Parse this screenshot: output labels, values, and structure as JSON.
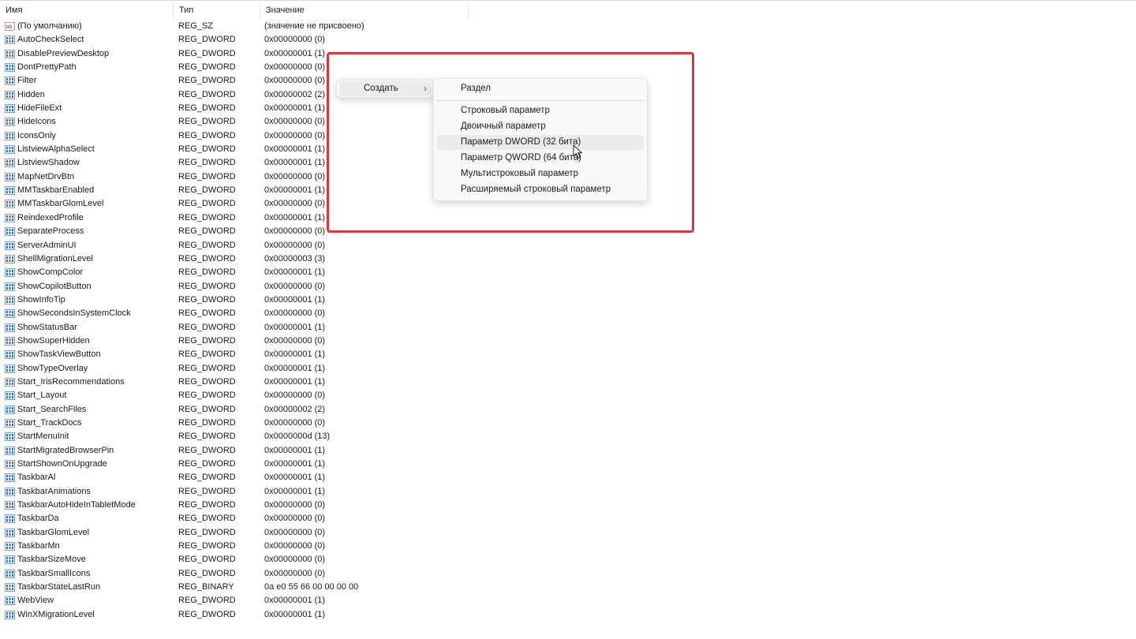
{
  "columns": {
    "name": "Имя",
    "type": "Тип",
    "value": "Значение"
  },
  "rows": [
    {
      "name": "(По умолчанию)",
      "type": "REG_SZ",
      "value": "(значение не присвоено)",
      "icon": "string-value-icon"
    },
    {
      "name": "AutoCheckSelect",
      "type": "REG_DWORD",
      "value": "0x00000000 (0)",
      "icon": "binary-value-icon"
    },
    {
      "name": "DisablePreviewDesktop",
      "type": "REG_DWORD",
      "value": "0x00000001 (1)",
      "icon": "binary-value-icon"
    },
    {
      "name": "DontPrettyPath",
      "type": "REG_DWORD",
      "value": "0x00000000 (0)",
      "icon": "binary-value-icon"
    },
    {
      "name": "Filter",
      "type": "REG_DWORD",
      "value": "0x00000000 (0)",
      "icon": "binary-value-icon"
    },
    {
      "name": "Hidden",
      "type": "REG_DWORD",
      "value": "0x00000002 (2)",
      "icon": "binary-value-icon"
    },
    {
      "name": "HideFileExt",
      "type": "REG_DWORD",
      "value": "0x00000001 (1)",
      "icon": "binary-value-icon"
    },
    {
      "name": "HideIcons",
      "type": "REG_DWORD",
      "value": "0x00000000 (0)",
      "icon": "binary-value-icon"
    },
    {
      "name": "IconsOnly",
      "type": "REG_DWORD",
      "value": "0x00000000 (0)",
      "icon": "binary-value-icon"
    },
    {
      "name": "ListviewAlphaSelect",
      "type": "REG_DWORD",
      "value": "0x00000001 (1)",
      "icon": "binary-value-icon"
    },
    {
      "name": "ListviewShadow",
      "type": "REG_DWORD",
      "value": "0x00000001 (1)",
      "icon": "binary-value-icon"
    },
    {
      "name": "MapNetDrvBtn",
      "type": "REG_DWORD",
      "value": "0x00000000 (0)",
      "icon": "binary-value-icon"
    },
    {
      "name": "MMTaskbarEnabled",
      "type": "REG_DWORD",
      "value": "0x00000001 (1)",
      "icon": "binary-value-icon"
    },
    {
      "name": "MMTaskbarGlomLevel",
      "type": "REG_DWORD",
      "value": "0x00000000 (0)",
      "icon": "binary-value-icon"
    },
    {
      "name": "ReindexedProfile",
      "type": "REG_DWORD",
      "value": "0x00000001 (1)",
      "icon": "binary-value-icon"
    },
    {
      "name": "SeparateProcess",
      "type": "REG_DWORD",
      "value": "0x00000000 (0)",
      "icon": "binary-value-icon"
    },
    {
      "name": "ServerAdminUI",
      "type": "REG_DWORD",
      "value": "0x00000000 (0)",
      "icon": "binary-value-icon"
    },
    {
      "name": "ShellMigrationLevel",
      "type": "REG_DWORD",
      "value": "0x00000003 (3)",
      "icon": "binary-value-icon"
    },
    {
      "name": "ShowCompColor",
      "type": "REG_DWORD",
      "value": "0x00000001 (1)",
      "icon": "binary-value-icon"
    },
    {
      "name": "ShowCopilotButton",
      "type": "REG_DWORD",
      "value": "0x00000000 (0)",
      "icon": "binary-value-icon"
    },
    {
      "name": "ShowInfoTip",
      "type": "REG_DWORD",
      "value": "0x00000001 (1)",
      "icon": "binary-value-icon"
    },
    {
      "name": "ShowSecondsInSystemClock",
      "type": "REG_DWORD",
      "value": "0x00000000 (0)",
      "icon": "binary-value-icon"
    },
    {
      "name": "ShowStatusBar",
      "type": "REG_DWORD",
      "value": "0x00000001 (1)",
      "icon": "binary-value-icon"
    },
    {
      "name": "ShowSuperHidden",
      "type": "REG_DWORD",
      "value": "0x00000000 (0)",
      "icon": "binary-value-icon"
    },
    {
      "name": "ShowTaskViewButton",
      "type": "REG_DWORD",
      "value": "0x00000001 (1)",
      "icon": "binary-value-icon"
    },
    {
      "name": "ShowTypeOverlay",
      "type": "REG_DWORD",
      "value": "0x00000001 (1)",
      "icon": "binary-value-icon"
    },
    {
      "name": "Start_IrisRecommendations",
      "type": "REG_DWORD",
      "value": "0x00000001 (1)",
      "icon": "binary-value-icon"
    },
    {
      "name": "Start_Layout",
      "type": "REG_DWORD",
      "value": "0x00000000 (0)",
      "icon": "binary-value-icon"
    },
    {
      "name": "Start_SearchFiles",
      "type": "REG_DWORD",
      "value": "0x00000002 (2)",
      "icon": "binary-value-icon"
    },
    {
      "name": "Start_TrackDocs",
      "type": "REG_DWORD",
      "value": "0x00000000 (0)",
      "icon": "binary-value-icon"
    },
    {
      "name": "StartMenuInit",
      "type": "REG_DWORD",
      "value": "0x0000000d (13)",
      "icon": "binary-value-icon"
    },
    {
      "name": "StartMigratedBrowserPin",
      "type": "REG_DWORD",
      "value": "0x00000001 (1)",
      "icon": "binary-value-icon"
    },
    {
      "name": "StartShownOnUpgrade",
      "type": "REG_DWORD",
      "value": "0x00000001 (1)",
      "icon": "binary-value-icon"
    },
    {
      "name": "TaskbarAl",
      "type": "REG_DWORD",
      "value": "0x00000001 (1)",
      "icon": "binary-value-icon"
    },
    {
      "name": "TaskbarAnimations",
      "type": "REG_DWORD",
      "value": "0x00000001 (1)",
      "icon": "binary-value-icon"
    },
    {
      "name": "TaskbarAutoHideInTabletMode",
      "type": "REG_DWORD",
      "value": "0x00000000 (0)",
      "icon": "binary-value-icon"
    },
    {
      "name": "TaskbarDa",
      "type": "REG_DWORD",
      "value": "0x00000000 (0)",
      "icon": "binary-value-icon"
    },
    {
      "name": "TaskbarGlomLevel",
      "type": "REG_DWORD",
      "value": "0x00000000 (0)",
      "icon": "binary-value-icon"
    },
    {
      "name": "TaskbarMn",
      "type": "REG_DWORD",
      "value": "0x00000000 (0)",
      "icon": "binary-value-icon"
    },
    {
      "name": "TaskbarSizeMove",
      "type": "REG_DWORD",
      "value": "0x00000000 (0)",
      "icon": "binary-value-icon"
    },
    {
      "name": "TaskbarSmallIcons",
      "type": "REG_DWORD",
      "value": "0x00000000 (0)",
      "icon": "binary-value-icon"
    },
    {
      "name": "TaskbarStateLastRun",
      "type": "REG_BINARY",
      "value": "0a e0 55 66 00 00 00 00",
      "icon": "binary-value-icon"
    },
    {
      "name": "WebView",
      "type": "REG_DWORD",
      "value": "0x00000001 (1)",
      "icon": "binary-value-icon"
    },
    {
      "name": "WinXMigrationLevel",
      "type": "REG_DWORD",
      "value": "0x00000001 (1)",
      "icon": "binary-value-icon"
    }
  ],
  "context_menu": {
    "create_label": "Создать",
    "chevron": "›",
    "submenu": {
      "key": "Раздел",
      "string": "Строковый параметр",
      "binary": "Двоичный параметр",
      "dword": "Параметр DWORD (32 бита)",
      "qword": "Параметр QWORD (64 бита)",
      "multi_string": "Мультистроковый параметр",
      "expandable_string": "Расширяемый строковый параметр"
    },
    "hovered_item": "dword"
  },
  "colors": {
    "highlight_box": "#d9373e",
    "menu_background": "#f9f9f9",
    "menu_hover": "#ececec",
    "icon_blue": "#2e6ebf",
    "icon_red": "#c0392b"
  }
}
